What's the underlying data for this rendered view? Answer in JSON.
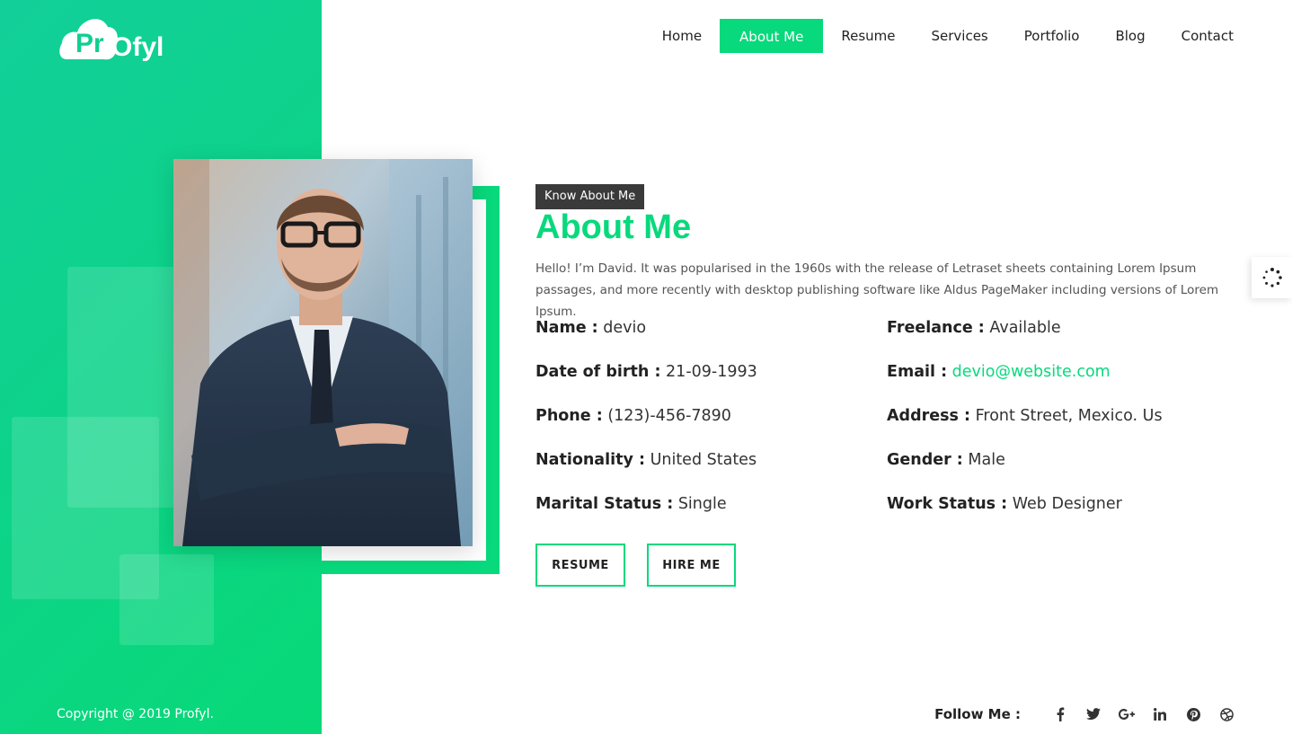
{
  "brand": {
    "logo_text": "Profyl"
  },
  "nav": {
    "items": [
      "Home",
      "About Me",
      "Resume",
      "Services",
      "Portfolio",
      "Blog",
      "Contact"
    ],
    "active": "About Me"
  },
  "about": {
    "tag": "Know About Me",
    "title": "About Me",
    "intro": "Hello! I’m David. It was popularised in the 1960s with the release of Letraset sheets containing Lorem Ipsum passages, and more recently with desktop publishing software like Aldus PageMaker including versions of Lorem Ipsum."
  },
  "info_left": [
    {
      "label": "Name :",
      "value": "devio"
    },
    {
      "label": "Date of birth :",
      "value": "21-09-1993"
    },
    {
      "label": "Phone :",
      "value": "(123)-456-7890"
    },
    {
      "label": "Nationality :",
      "value": "United States"
    },
    {
      "label": "Marital Status :",
      "value": "Single"
    }
  ],
  "info_right": [
    {
      "label": "Freelance :",
      "value": "Available"
    },
    {
      "label": "Email :",
      "value": "devio@website.com"
    },
    {
      "label": "Address :",
      "value": "Front Street, Mexico. Us"
    },
    {
      "label": "Gender :",
      "value": "Male"
    },
    {
      "label": "Work Status :",
      "value": "Web Designer"
    }
  ],
  "buttons": {
    "resume": "RESUME",
    "hire": "HIRE ME"
  },
  "footer": {
    "copyright": "Copyright @ 2019 Profyl.",
    "follow_label": "Follow Me :",
    "social_icons": [
      "facebook-icon",
      "twitter-icon",
      "google-plus-icon",
      "linkedin-icon",
      "pinterest-icon",
      "dribbble-icon"
    ]
  },
  "colors": {
    "accent": "#08d97c",
    "tag_bg": "#3a3a3a"
  },
  "widget": {
    "icon": "loading-spinner-icon"
  }
}
